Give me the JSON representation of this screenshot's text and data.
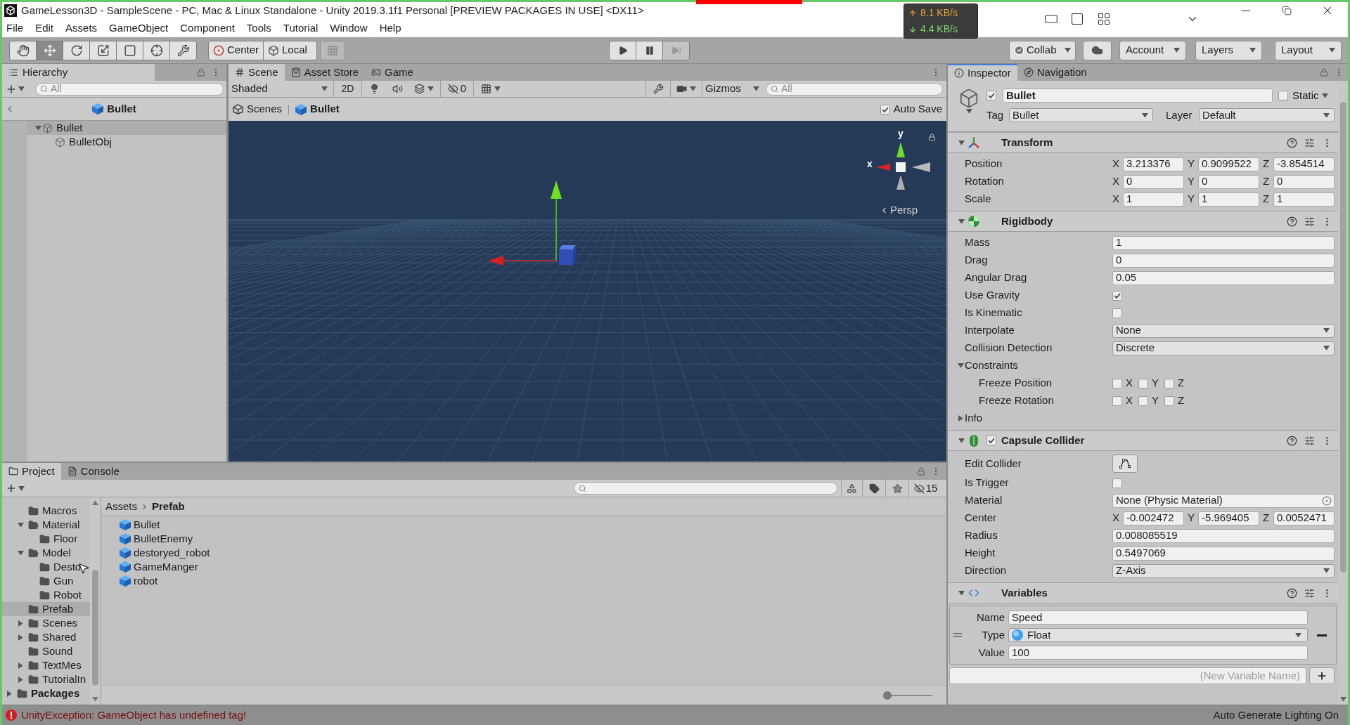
{
  "window": {
    "title": "GameLesson3D - SampleScene - PC, Mac & Linux Standalone - Unity 2019.3.1f1 Personal [PREVIEW PACKAGES IN USE] <DX11>"
  },
  "net_monitor": {
    "upload": "8.1 KB/s",
    "download": "4.4 KB/s"
  },
  "menu": [
    "File",
    "Edit",
    "Assets",
    "GameObject",
    "Component",
    "Tools",
    "Tutorial",
    "Window",
    "Help"
  ],
  "toolbar": {
    "tools": [
      {
        "kind": "hand",
        "selected": false
      },
      {
        "kind": "move",
        "selected": true
      },
      {
        "kind": "rotate",
        "selected": false
      },
      {
        "kind": "scale",
        "selected": false
      },
      {
        "kind": "rect",
        "selected": false
      },
      {
        "kind": "transform",
        "selected": false
      },
      {
        "kind": "custom",
        "selected": false
      }
    ],
    "pivot": "Center",
    "space": "Local",
    "snap": {
      "disabled": true
    },
    "playback": [
      {
        "kind": "play",
        "disabled": false
      },
      {
        "kind": "pause",
        "disabled": false
      },
      {
        "kind": "step",
        "disabled": true
      }
    ],
    "collab": "Collab",
    "account": "Account",
    "layers": "Layers",
    "layout": "Layout"
  },
  "hierarchy": {
    "focused": false,
    "tab": "Hierarchy",
    "search_placeholder": "All",
    "prefab_header": "Bullet",
    "tree": [
      {
        "label": "Bullet",
        "selected": true,
        "expanded": true,
        "children": [
          {
            "label": "BulletObj",
            "selected": false
          }
        ]
      }
    ]
  },
  "scene": {
    "focused": false,
    "tabs": [
      {
        "kind": "scene",
        "label": "Scene",
        "selected": true
      },
      {
        "kind": "store",
        "label": "Asset Store",
        "selected": false
      },
      {
        "kind": "game",
        "label": "Game",
        "selected": false
      }
    ],
    "draw_mode": "Shaded",
    "mode_2d": "2D",
    "lighting": {
      "on": true
    },
    "hidden_count": "0",
    "tools": {
      "on": false
    },
    "gizmos": "Gizmos",
    "search_placeholder": "All",
    "breadcrumb": [
      "Scenes",
      "Bullet"
    ],
    "auto_save": {
      "label": "Auto Save",
      "checked": true
    },
    "view_gizmo": {
      "y_label": "y",
      "x_label": "x",
      "projection": "Persp"
    }
  },
  "inspector": {
    "focused": true,
    "tabs": [
      {
        "kind": "info",
        "label": "Inspector",
        "selected": true
      },
      {
        "kind": "navigation",
        "label": "Navigation",
        "selected": false
      }
    ],
    "object": {
      "active": true,
      "name": "Bullet",
      "static_label": "Static",
      "static": false,
      "tag_label": "Tag",
      "tag": "Bullet",
      "layer_label": "Layer",
      "layer": "Default"
    },
    "components": [
      {
        "kind": "transform",
        "title": "Transform",
        "expanded": true,
        "properties": [
          {
            "kind": "vector3",
            "label": "Position",
            "values": [
              {
                "axis": "X",
                "value": "3.213376"
              },
              {
                "axis": "Y",
                "value": "0.9099522"
              },
              {
                "axis": "Z",
                "value": "-3.854514"
              }
            ]
          },
          {
            "kind": "vector3",
            "label": "Rotation",
            "values": [
              {
                "axis": "X",
                "value": "0"
              },
              {
                "axis": "Y",
                "value": "0"
              },
              {
                "axis": "Z",
                "value": "0"
              }
            ]
          },
          {
            "kind": "vector3",
            "label": "Scale",
            "values": [
              {
                "axis": "X",
                "value": "1"
              },
              {
                "axis": "Y",
                "value": "1"
              },
              {
                "axis": "Z",
                "value": "1"
              }
            ]
          }
        ]
      },
      {
        "kind": "rigidbody",
        "title": "Rigidbody",
        "expanded": true,
        "properties": [
          {
            "kind": "text",
            "label": "Mass",
            "value": "1"
          },
          {
            "kind": "text",
            "label": "Drag",
            "value": "0"
          },
          {
            "kind": "text",
            "label": "Angular Drag",
            "value": "0.05"
          },
          {
            "kind": "checkbox",
            "label": "Use Gravity",
            "checked": true
          },
          {
            "kind": "checkbox",
            "label": "Is Kinematic",
            "checked": false
          },
          {
            "kind": "dropdown",
            "label": "Interpolate",
            "value": "None"
          },
          {
            "kind": "dropdown",
            "label": "Collision Detection",
            "value": "Discrete"
          },
          {
            "kind": "foldout",
            "label": "Constraints",
            "expanded": true,
            "children": [
              {
                "kind": "axes",
                "label": "Freeze Position",
                "axes": [
                  {
                    "label": "X",
                    "checked": false
                  },
                  {
                    "label": "Y",
                    "checked": false
                  },
                  {
                    "label": "Z",
                    "checked": false
                  }
                ]
              },
              {
                "kind": "axes",
                "label": "Freeze Rotation",
                "axes": [
                  {
                    "label": "X",
                    "checked": false
                  },
                  {
                    "label": "Y",
                    "checked": false
                  },
                  {
                    "label": "Z",
                    "checked": false
                  }
                ]
              }
            ]
          },
          {
            "kind": "foldout",
            "label": "Info",
            "expanded": false
          }
        ]
      },
      {
        "kind": "capsule_collider",
        "title": "Capsule Collider",
        "expanded": true,
        "enabled": true,
        "properties": [
          {
            "kind": "button",
            "label": "Edit Collider"
          },
          {
            "kind": "checkbox",
            "label": "Is Trigger",
            "checked": false
          },
          {
            "kind": "object",
            "label": "Material",
            "value": "None (Physic Material)"
          },
          {
            "kind": "vector3",
            "label": "Center",
            "values": [
              {
                "axis": "X",
                "value": "-0.002472"
              },
              {
                "axis": "Y",
                "value": "-5.969405"
              },
              {
                "axis": "Z",
                "value": "0.0052471"
              }
            ]
          },
          {
            "kind": "text",
            "label": "Radius",
            "value": "0.008085519"
          },
          {
            "kind": "text",
            "label": "Height",
            "value": "0.5497069"
          },
          {
            "kind": "dropdown",
            "label": "Direction",
            "value": "Z-Axis"
          }
        ]
      },
      {
        "kind": "variables",
        "title": "Variables",
        "expanded": true,
        "variables": [
          {
            "name_label": "Name",
            "name": "Speed",
            "type_label": "Type",
            "type": "Float",
            "value_label": "Value",
            "value": "100"
          }
        ],
        "new_variable": {
          "placeholder": "(New Variable Name)"
        }
      }
    ]
  },
  "project": {
    "focused": false,
    "tabs": [
      {
        "kind": "project",
        "label": "Project",
        "selected": true
      },
      {
        "kind": "console",
        "label": "Console",
        "selected": false
      }
    ],
    "hidden_packages": "15",
    "tree": [
      {
        "label": "Macros",
        "selected": false
      },
      {
        "label": "Material",
        "selected": false,
        "expanded": true,
        "children": [
          {
            "label": "Floor",
            "selected": false
          }
        ]
      },
      {
        "label": "Model",
        "selected": false,
        "expanded": true,
        "children": [
          {
            "label": "Desto",
            "selected": false
          },
          {
            "label": "Gun",
            "selected": false
          },
          {
            "label": "Robot",
            "selected": false
          }
        ]
      },
      {
        "label": "Prefab",
        "selected": true
      },
      {
        "label": "Scenes",
        "selected": false,
        "expanded": false
      },
      {
        "label": "Shared",
        "selected": false,
        "expanded": false
      },
      {
        "label": "Sound",
        "selected": false
      },
      {
        "label": "TextMes",
        "selected": false,
        "expanded": false
      },
      {
        "label": "TutorialIn",
        "selected": false,
        "expanded": false
      }
    ],
    "packages": {
      "label": "Packages",
      "expanded": false
    },
    "breadcrumb": [
      "Assets",
      "Prefab"
    ],
    "items": [
      "Bullet",
      "BulletEnemy",
      "destoryed_robot",
      "GameManger",
      "robot"
    ],
    "zoom_slider": {
      "level": 0
    }
  },
  "status_bar": {
    "error": "UnityException: GameObject has undefined tag!",
    "lighting": "Auto Generate Lighting On"
  }
}
